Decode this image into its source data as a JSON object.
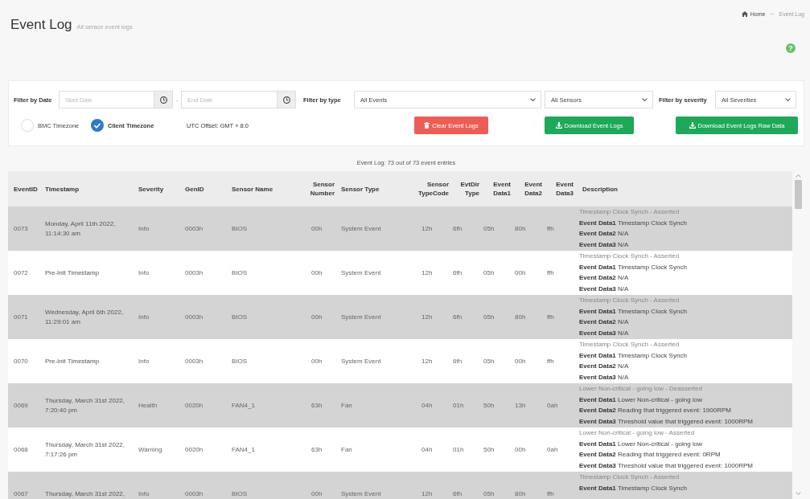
{
  "header": {
    "title": "Event Log",
    "subtitle": "All sensor event logs",
    "breadcrumb": [
      {
        "label": "Home",
        "kind": "home"
      },
      {
        "label": "Event Log",
        "kind": "current"
      }
    ],
    "help": "?"
  },
  "filters": {
    "date": {
      "label": "Filter by Date",
      "start": {
        "placeholder": "Start Date"
      },
      "separator": "-",
      "end": {
        "placeholder": "End Date"
      }
    },
    "type": {
      "label": "Filter by type",
      "selects": [
        {
          "value": "All Events"
        },
        {
          "value": "All Sensors"
        }
      ]
    },
    "severity": {
      "label": "Filter by severity",
      "select": {
        "value": "All Severities"
      }
    },
    "timezones": [
      {
        "label": "BMC Timezone",
        "selected": false
      },
      {
        "label": "Client Timezone",
        "selected": true
      }
    ],
    "utc_offset": "UTC Offset: GMT + 8:0",
    "buttons": [
      {
        "label": "Clear Event Logs",
        "kind": "clear"
      },
      {
        "label": "Download Event Logs",
        "kind": "download"
      },
      {
        "label": "Download Event Logs Raw Data",
        "kind": "download"
      }
    ]
  },
  "table": {
    "summary": "Event Log: 73 out of 73 event entries",
    "columns": [
      "EventID",
      "Timestamp",
      "Severity",
      "GenID",
      "Sensor Name",
      "Sensor Number",
      "Sensor Type",
      "Sensor TypeCode",
      "EvtDir Type",
      "Event Data1",
      "Event Data2",
      "Event Data3",
      "Description"
    ],
    "rows": [
      {
        "cells": [
          "0073",
          "Monday, April 11th 2022, 11:14:30 am",
          "Info",
          "0003h",
          "BIOS",
          "00h",
          "System Event",
          "12h",
          "6fh",
          "05h",
          "80h",
          "ffh"
        ],
        "description": [
          "Timestamp Clock Synch - Asserted",
          "**Event Data1** Timestamp Clock Synch",
          "**Event Data2** N/A",
          "**Event Data3** N/A"
        ]
      },
      {
        "cells": [
          "0072",
          "Pre-Init Timestamp",
          "Info",
          "0003h",
          "BIOS",
          "00h",
          "System Event",
          "12h",
          "6fh",
          "05h",
          "00h",
          "ffh"
        ],
        "description": [
          "Timestamp Clock Synch - Asserted",
          "**Event Data1** Timestamp Clock Synch",
          "**Event Data2** N/A",
          "**Event Data3** N/A"
        ]
      },
      {
        "cells": [
          "0071",
          "Wednesday, April 6th 2022, 11:29:01 am",
          "Info",
          "0003h",
          "BIOS",
          "00h",
          "System Event",
          "12h",
          "6fh",
          "05h",
          "80h",
          "ffh"
        ],
        "description": [
          "Timestamp Clock Synch - Asserted",
          "**Event Data1** Timestamp Clock Synch",
          "**Event Data2** N/A",
          "**Event Data3** N/A"
        ]
      },
      {
        "cells": [
          "0070",
          "Pre-Init Timestamp",
          "Info",
          "0003h",
          "BIOS",
          "00h",
          "System Event",
          "12h",
          "6fh",
          "05h",
          "00h",
          "ffh"
        ],
        "description": [
          "Timestamp Clock Synch - Asserted",
          "**Event Data1** Timestamp Clock Synch",
          "**Event Data2** N/A",
          "**Event Data3** N/A"
        ]
      },
      {
        "cells": [
          "0069",
          "Thursday, March 31st 2022, 7:20:40 pm",
          "Health",
          "0020h",
          "FAN4_1",
          "63h",
          "Fan",
          "04h",
          "01h",
          "50h",
          "13h",
          "0ah"
        ],
        "description": [
          "Lower Non-critical - going low - Deasserted",
          "**Event Data1** Lower Non-critical - going low",
          "**Event Data2** Reading that triggered event: 1900RPM",
          "**Event Data3** Threshold value that triggered event: 1000RPM"
        ]
      },
      {
        "cells": [
          "0068",
          "Thursday, March 31st 2022, 7:17:26 pm",
          "Warning",
          "0020h",
          "FAN4_1",
          "63h",
          "Fan",
          "04h",
          "01h",
          "50h",
          "00h",
          "0ah"
        ],
        "description": [
          "Lower Non-critical - going low - Asserted",
          "**Event Data1** Lower Non-critical - going low",
          "**Event Data2** Reading that triggered event: 0RPM",
          "**Event Data3** Threshold value that triggered event: 1000RPM"
        ]
      },
      {
        "cells": [
          "0067",
          "Thursday, March 31st 2022,",
          "Info",
          "0003h",
          "BIOS",
          "00h",
          "System Event",
          "12h",
          "6fh",
          "05h",
          "80h",
          "ffh"
        ],
        "description": [
          "Timestamp Clock Synch - Asserted",
          "**Event Data1** Timestamp Clock Synch"
        ]
      }
    ]
  }
}
